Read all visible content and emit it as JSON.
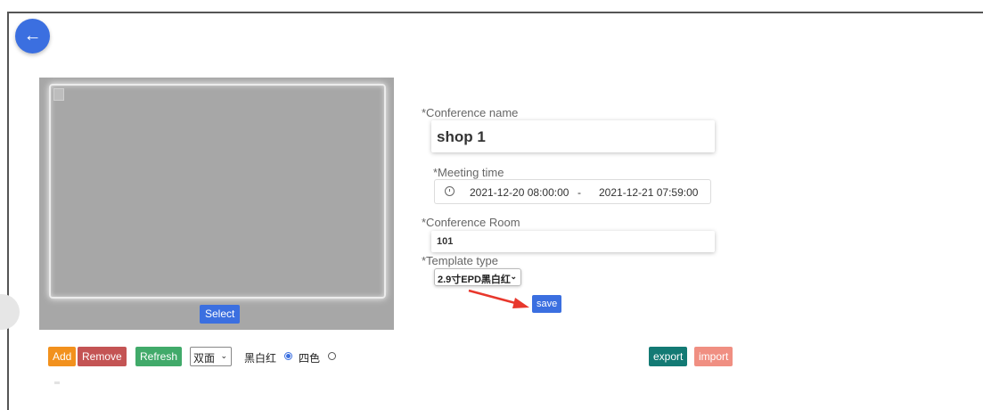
{
  "nav": {
    "back_icon": "←"
  },
  "preview": {
    "select_label": "Select"
  },
  "form": {
    "conference_name": {
      "label": "*Conference name",
      "value": "shop 1"
    },
    "meeting_time": {
      "label": "*Meeting time",
      "start": "2021-12-20 08:00:00",
      "separator": "-",
      "end": "2021-12-21 07:59:00"
    },
    "conference_room": {
      "label": "*Conference Room",
      "value": "101"
    },
    "template_type": {
      "label": "*Template type",
      "value": "2.9寸EPD黑白红"
    },
    "save_label": "save"
  },
  "toolbar": {
    "add_label": "Add",
    "remove_label": "Remove",
    "refresh_label": "Refresh",
    "side_select_value": "双面",
    "color_mode_1": "黑白红",
    "color_mode_2": "四色",
    "export_label": "export",
    "import_label": "import"
  },
  "colors": {
    "primary": "#3b6fe0",
    "add": "#f2911d",
    "remove": "#c45454",
    "refresh": "#41aa6a",
    "export": "#137a74",
    "import": "#f08f82",
    "annotation_arrow": "#e8372c"
  }
}
